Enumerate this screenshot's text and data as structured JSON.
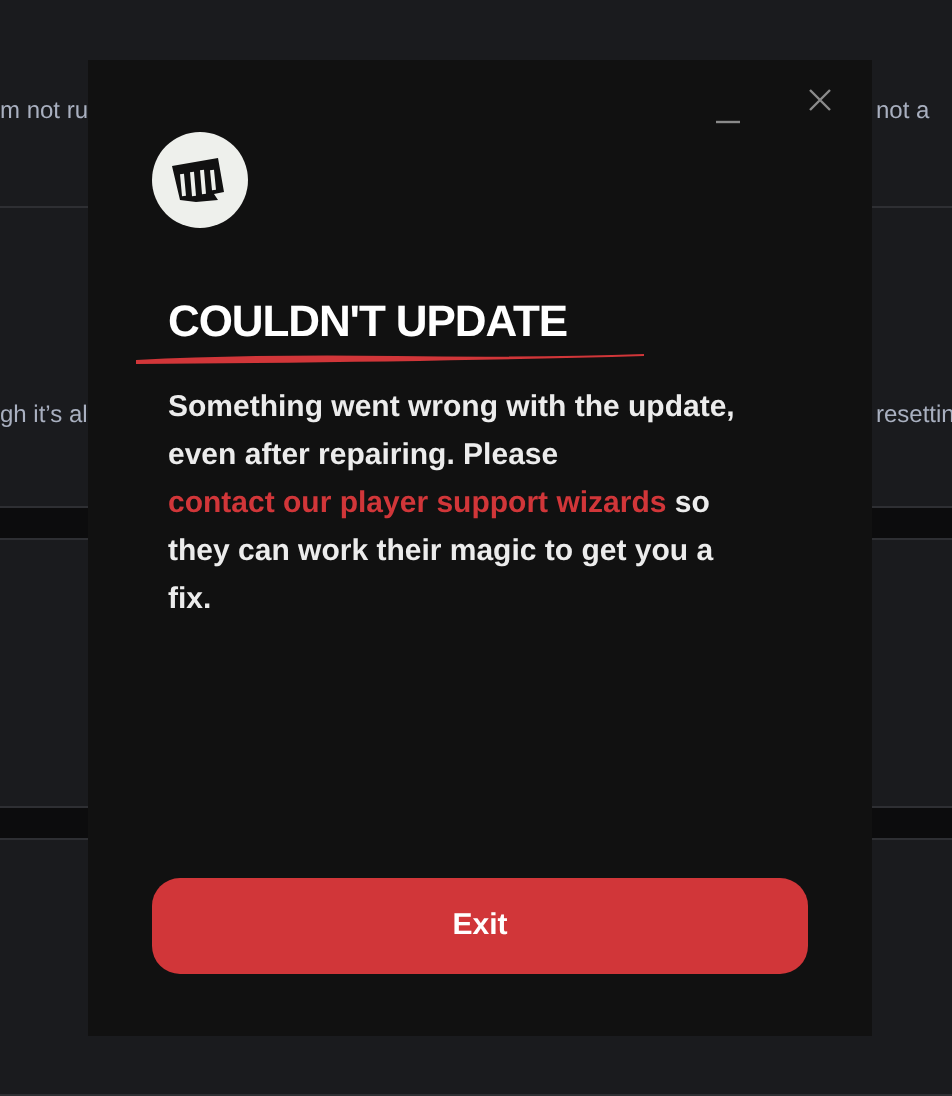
{
  "background": {
    "rows": [
      {
        "left_text": "m not ru",
        "right_text": "not a"
      },
      {
        "left_text": "gh it’s al",
        "right_text": "resettin"
      }
    ]
  },
  "dialog": {
    "title": "COULDN'T UPDATE",
    "message": {
      "before": "Something went wrong with the update, even after repairing. Please ",
      "link": "contact our player support wizards",
      "after": " so they can work their magic to get you a fix."
    },
    "button": "Exit"
  }
}
